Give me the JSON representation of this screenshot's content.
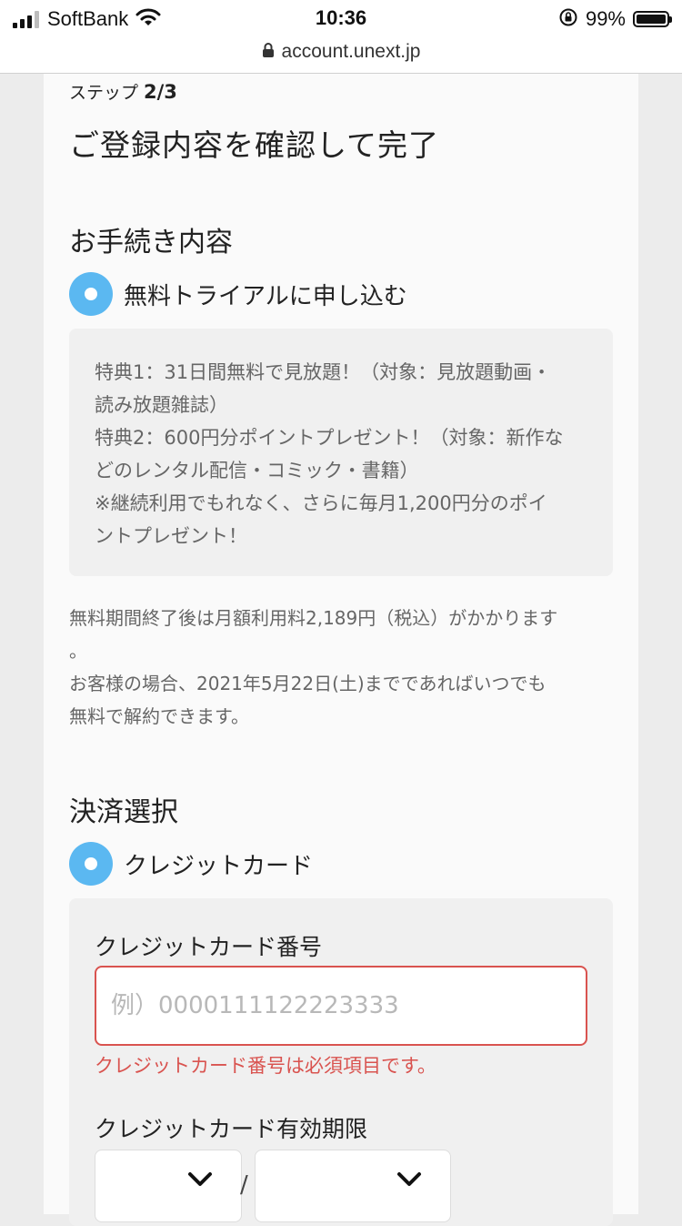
{
  "status_bar": {
    "carrier": "SoftBank",
    "time": "10:36",
    "battery": "99%"
  },
  "browser": {
    "url": "account.unext.jp"
  },
  "page": {
    "step_label": "ステップ",
    "step_value": "2/3",
    "title": "ご登録内容を確認して完了"
  },
  "procedure": {
    "section_title": "お手続き内容",
    "option_label": "無料トライアルに申し込む",
    "benefits": [
      "特典1：31日間無料で見放題！（対象：見放題動画・",
      "読み放題雑誌）",
      "特典2：600円分ポイントプレゼント！（対象：新作な",
      "どのレンタル配信・コミック・書籍）",
      "※継続利用でもれなく、さらに毎月1,200円分のポイ",
      "ントプレゼント！"
    ],
    "notice": [
      "無料期間終了後は月額利用料2,189円（税込）がかかります",
      "。",
      "お客様の場合、2021年5月22日(土)までであればいつでも",
      "無料で解約できます。"
    ]
  },
  "payment": {
    "section_title": "決済選択",
    "option_label": "クレジットカード",
    "card_number_label": "クレジットカード番号",
    "card_number_placeholder": "例）0000111122223333",
    "card_number_error": "クレジットカード番号は必須項目です。",
    "expiry_label": "クレジットカード有効期限",
    "expiry_separator": "/"
  },
  "icons": {
    "accent_color": "#5bb8f1",
    "error_color": "#d9534f"
  }
}
